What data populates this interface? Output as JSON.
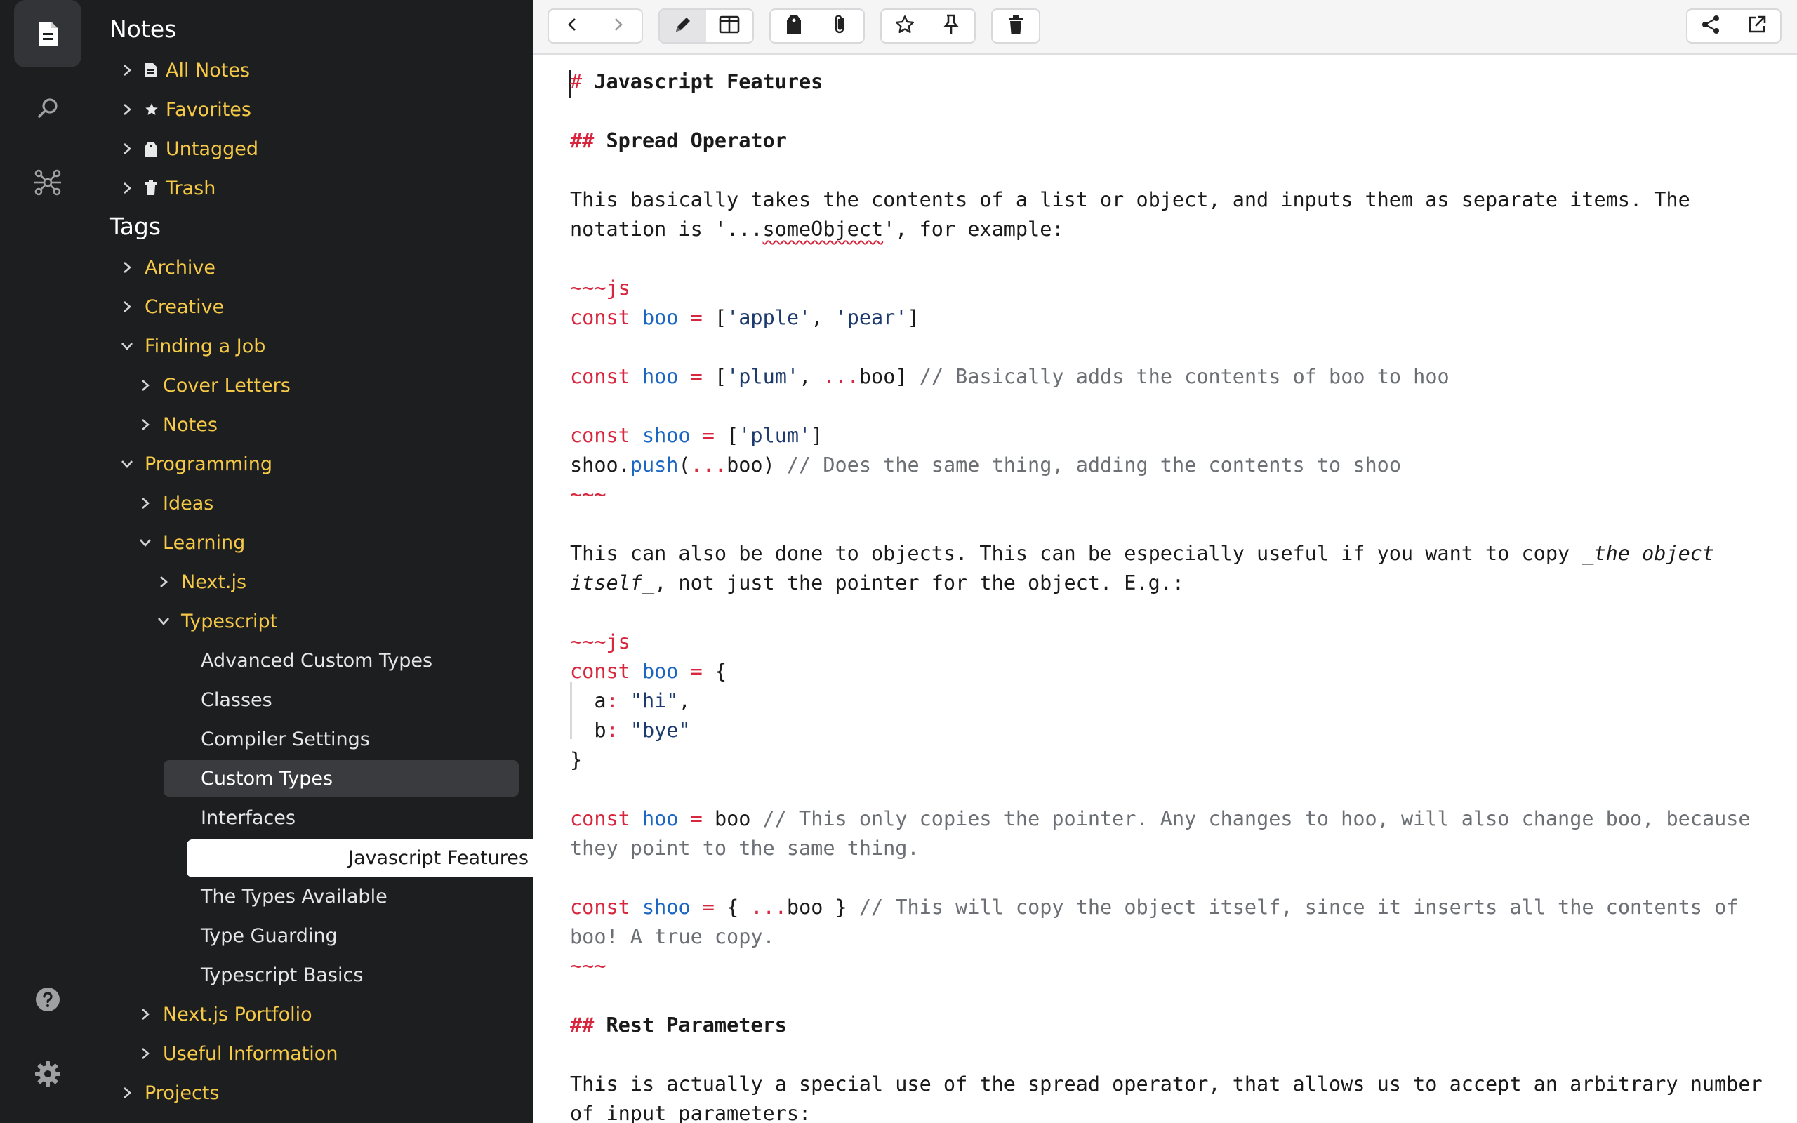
{
  "rail": {
    "top_items": [
      {
        "name": "notes-icon",
        "active": true
      },
      {
        "name": "search-icon",
        "active": false
      },
      {
        "name": "graph-icon",
        "active": false
      }
    ],
    "bottom_items": [
      {
        "name": "help-icon"
      },
      {
        "name": "settings-icon"
      }
    ]
  },
  "sidebar": {
    "notes_title": "Notes",
    "notes_items": [
      {
        "label": "All Notes",
        "icon": "document-icon"
      },
      {
        "label": "Favorites",
        "icon": "star-icon"
      },
      {
        "label": "Untagged",
        "icon": "tag-icon"
      },
      {
        "label": "Trash",
        "icon": "trash-icon"
      }
    ],
    "tags_title": "Tags",
    "tags": {
      "archive": "Archive",
      "creative": "Creative",
      "finding_a_job": "Finding a Job",
      "cover_letters": "Cover Letters",
      "notes": "Notes",
      "programming": "Programming",
      "ideas": "Ideas",
      "learning": "Learning",
      "nextjs": "Next.js",
      "typescript": "Typescript",
      "nextjs_portfolio": "Next.js Portfolio",
      "useful_information": "Useful Information",
      "projects": "Projects"
    },
    "typescript_notes": [
      "Advanced Custom Types",
      "Classes",
      "Compiler Settings",
      "Custom Types",
      "Interfaces",
      "Javascript Features",
      "The Types Available",
      "Type Guarding",
      "Typescript Basics"
    ],
    "selected_note": "Custom Types",
    "current_note": "Javascript Features"
  },
  "toolbar": {
    "buttons": [
      "back-icon",
      "forward-icon",
      "edit-icon",
      "split-view-icon",
      "tag-icon",
      "attachment-icon",
      "star-icon",
      "pin-icon",
      "trash-icon",
      "share-icon",
      "open-external-icon"
    ],
    "active": [
      "edit-icon"
    ]
  },
  "editor": {
    "h1_mark": "#",
    "h1_text": " Javascript Features",
    "h2a_mark": "##",
    "h2a_text": " Spread Operator",
    "p1_l1": "This basically takes the contents of a list or object, and inputs them as separate items. The",
    "p1_l2_a": "notation is '...",
    "p1_l2_b": "someObject",
    "p1_l2_c": "', for example:",
    "fence_js": "~~~js",
    "fence_end": "~~~",
    "c1": {
      "kw": "const",
      "v": "boo",
      "op": " = ",
      "a": "[",
      "s1": "'apple'",
      "b": ", ",
      "s2": "'pear'",
      "c": "]"
    },
    "c2": {
      "kw": "const",
      "v": "hoo",
      "op": " = ",
      "a": "[",
      "s1": "'plum'",
      "b": ", ",
      "sp": "...",
      "x": "boo]",
      "cm": " // Basically adds the contents of boo to hoo"
    },
    "c3": {
      "kw": "const",
      "v": "shoo",
      "op": " = ",
      "a": "[",
      "s1": "'plum'",
      "c": "]"
    },
    "c4": {
      "a": "shoo.",
      "fn": "push",
      "b": "(",
      "sp": "...",
      "x": "boo)",
      "cm": " // Does the same thing, adding the contents to shoo"
    },
    "p2_l1_a": "This can also be done to objects. This can be especially useful if you want to copy _",
    "p2_l1_b": "the object",
    "p2_l2_a": "itself",
    "p2_l2_b": "_, not just the pointer for the object. E.g.:",
    "o1": {
      "kw": "const",
      "v": "boo",
      "op": " = ",
      "a": "{"
    },
    "o2": {
      "k": "  a",
      "c": ":",
      "s": " \"hi\"",
      "e": ","
    },
    "o3": {
      "k": "  b",
      "c": ":",
      "s": " \"bye\""
    },
    "o4": "}",
    "o5": {
      "kw": "const",
      "v": "hoo",
      "op": " = ",
      "x": "boo",
      "cm": " // This only copies the pointer. Any changes to hoo, will also change boo, because"
    },
    "o5b": "they point to the same thing.",
    "o6": {
      "kw": "const",
      "v": "shoo",
      "op": " = ",
      "a": "{ ",
      "sp": "...",
      "x": "boo }",
      "cm": " // This will copy the object itself, since it inserts all the contents of"
    },
    "o6b": "boo! A true copy.",
    "h2b_mark": "##",
    "h2b_text": " Rest Parameters",
    "p3_l1": "This is actually a special use of the spread operator, that allows us to accept an arbitrary number",
    "p3_l2": "of input parameters:"
  }
}
